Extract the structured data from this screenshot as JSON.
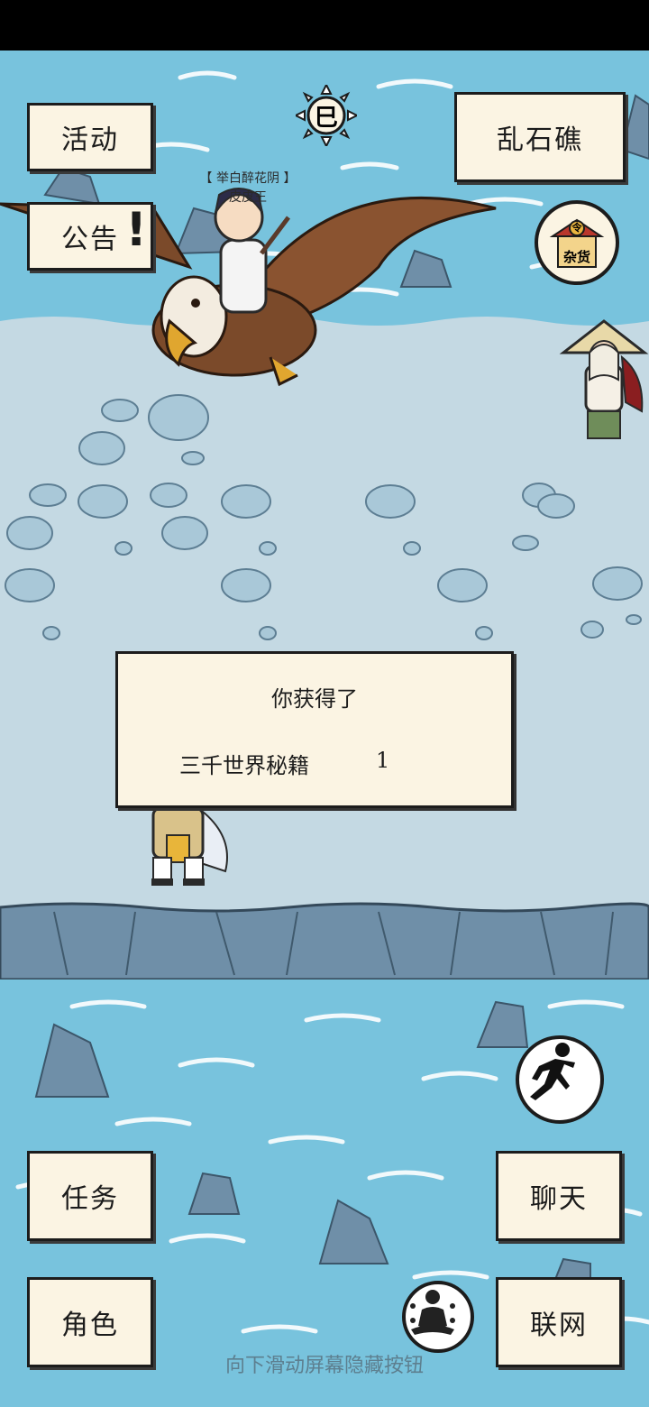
{
  "buttons": {
    "events": "活动",
    "notice": "公告",
    "location": "乱石礁",
    "quest": "任务",
    "character": "角色",
    "chat": "聊天",
    "network": "联网"
  },
  "icons": {
    "sun_glyph": "巳",
    "shop_badge": "杂货",
    "shop_coin": "令",
    "notice_alert": "!",
    "run": "run-icon",
    "meditate": "meditate-icon"
  },
  "npc": {
    "title": "【 举白醉花阴 】",
    "name": "皮皮王"
  },
  "reward_dialog": {
    "title": "你获得了",
    "item_name": "三千世界秘籍",
    "item_count": "1"
  },
  "hint": "向下滑动屏幕隐藏按钮",
  "colors": {
    "sea": "#78c3dd",
    "ice": "#c4d9e3",
    "cliff": "#6f8fa8",
    "panel": "#fbf4e3",
    "ink": "#1c1c1c"
  }
}
